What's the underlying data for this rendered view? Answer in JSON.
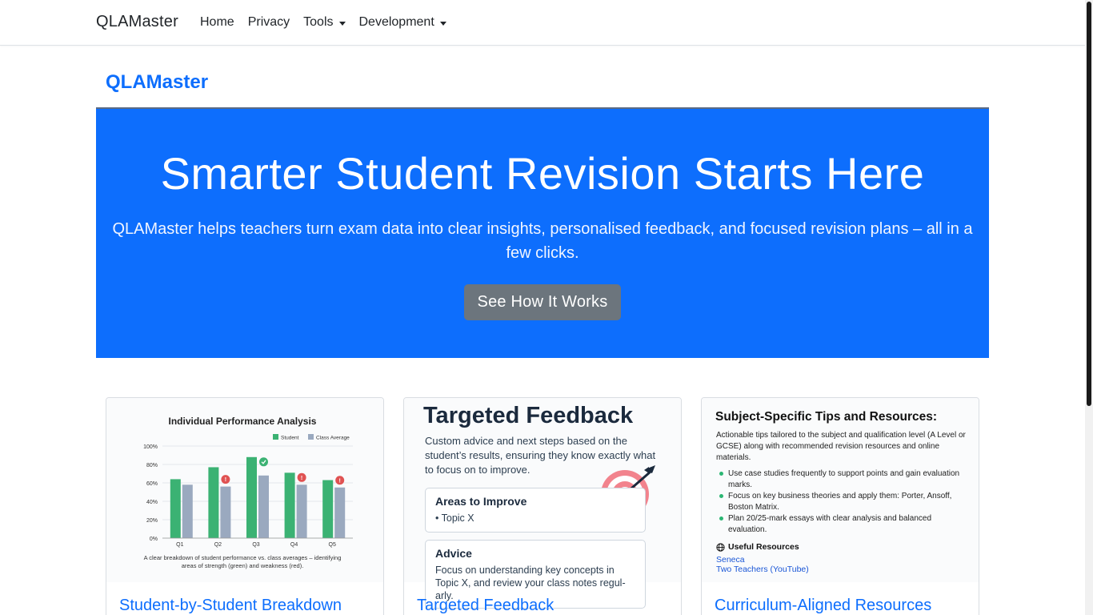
{
  "navbar": {
    "brand": "QLAMaster",
    "items": [
      {
        "label": "Home"
      },
      {
        "label": "Privacy"
      },
      {
        "label": "Tools"
      },
      {
        "label": "Development"
      }
    ]
  },
  "page_title": "QLAMaster",
  "hero": {
    "heading": "Smarter Student Revision Starts Here",
    "lead": "QLAMaster helps teachers turn exam data into clear insights, personalised feedback, and focused revision plans – all in a few clicks.",
    "button": "See How It Works"
  },
  "cards": [
    {
      "title": "Student-by-Student Breakdown",
      "image": {
        "heading": "Individual Performance Analysis",
        "caption": "A clear breakdown of student performance vs. class averages – identifying areas of strength (green) and weakness (red).",
        "chart_data": {
          "type": "bar",
          "categories": [
            "Q1",
            "Q2",
            "Q3",
            "Q4",
            "Q5"
          ],
          "series": [
            {
              "name": "Student",
              "values": [
                64,
                77,
                88,
                71,
                63
              ]
            },
            {
              "name": "Class Average",
              "values": [
                58,
                56,
                68,
                58,
                55
              ]
            }
          ],
          "ylim": [
            0,
            100
          ],
          "yticks": [
            "0%",
            "20%",
            "40%",
            "60%",
            "80%",
            "100%"
          ],
          "markers": [
            "",
            "warning",
            "check",
            "warning",
            "warning"
          ],
          "colors": {
            "student": "#3bb273",
            "class": "#9aa9bf",
            "warning": "#e05252",
            "check": "#3bb273"
          }
        }
      }
    },
    {
      "title": "Targeted Feedback",
      "image": {
        "heading": "Targeted Feedback",
        "description": "Custom advice and next steps based on the student’s results, ensuring they know exactly what to focus on to improve.",
        "box1_heading": "Areas to Improve",
        "box1_item": "• Topic X",
        "box2_heading": "Advice",
        "box2_text": "Focus on understanding key concepts in Topic X, and review your class notes regul-arly.",
        "icon": "target-icon"
      }
    },
    {
      "title": "Curriculum-Aligned Resources",
      "image": {
        "heading": "Subject-Specific Tips and Resources:",
        "description": "Actionable tips tailored to the subject and qualification level (A Level or GCSE) along with recommended revision resources and online materials.",
        "tips": [
          "Use case studies frequently to support points and gain evaluation marks.",
          "Focus on key business theories and apply them: Porter, Ansoff, Boston Matrix.",
          "Plan 20/25-mark essays with clear analysis and balanced evaluation."
        ],
        "resources_heading": "Useful Resources",
        "resources": [
          "Seneca",
          "Two Teachers (YouTube)"
        ]
      }
    }
  ]
}
